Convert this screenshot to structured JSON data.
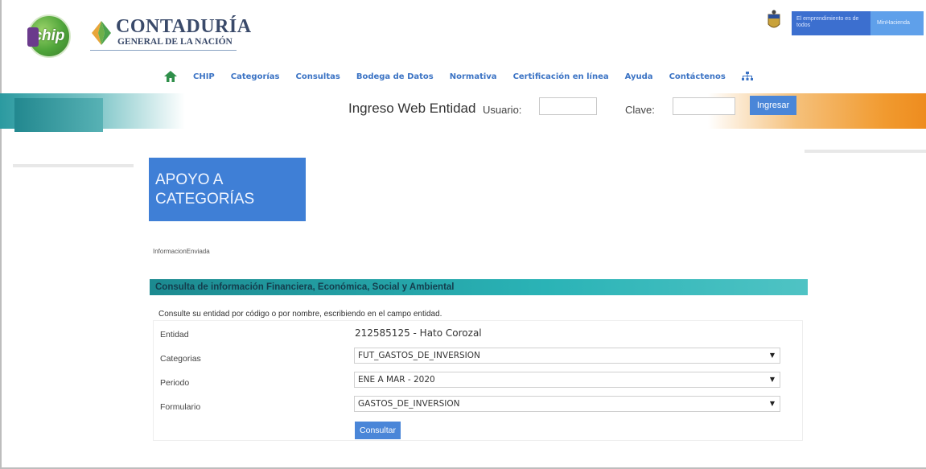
{
  "header": {
    "chip_logo_text": "chip",
    "org_title": "CONTADURÍA",
    "org_subtitle": "GENERAL DE LA NACIÓN",
    "gov_banner_left": "El emprendimiento es de todos",
    "gov_banner_right": "MinHacienda"
  },
  "nav": {
    "items": [
      "CHIP",
      "Categorías",
      "Consultas",
      "Bodega de Datos",
      "Normativa",
      "Certificación en línea",
      "Ayuda",
      "Contáctenos"
    ]
  },
  "login": {
    "title": "Ingreso Web Entidad",
    "user_label": "Usuario:",
    "password_label": "Clave:",
    "user_value": "",
    "password_value": "",
    "submit_label": "Ingresar"
  },
  "section": {
    "title_line1": "APOYO A",
    "title_line2": "CATEGORÍAS",
    "breadcrumb": "InformacionEnviada"
  },
  "consulta": {
    "header": "Consulta de información Financiera, Económica, Social y Ambiental",
    "help": "Consulte su entidad por código o por nombre, escribiendo en el campo entidad.",
    "fields": {
      "entidad_label": "Entidad",
      "entidad_value": "212585125 - Hato Corozal",
      "categorias_label": "Categorias",
      "categorias_value": "FUT_GASTOS_DE_INVERSION",
      "periodo_label": "Periodo",
      "periodo_value": "ENE A MAR - 2020",
      "formulario_label": "Formulario",
      "formulario_value": "GASTOS_DE_INVERSION"
    },
    "submit_label": "Consultar"
  },
  "colors": {
    "accent_blue": "#4a86d8",
    "teal": "#2ab3b6",
    "orange": "#f19a2f"
  }
}
